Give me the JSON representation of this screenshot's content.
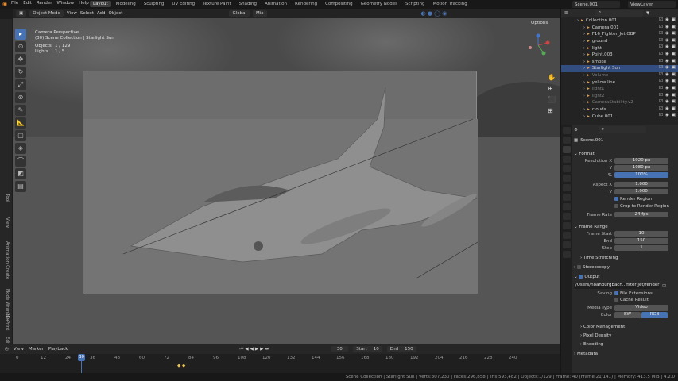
{
  "menu": [
    "File",
    "Edit",
    "Render",
    "Window",
    "Help"
  ],
  "workspaces": [
    "Layout",
    "Modeling",
    "Sculpting",
    "UV Editing",
    "Texture Paint",
    "Shading",
    "Animation",
    "Rendering",
    "Compositing",
    "Geometry Nodes",
    "Scripting",
    "Motion Tracking"
  ],
  "scene_name": "Scene.001",
  "view_layer": "ViewLayer",
  "viewport_header": {
    "mode": "Object Mode",
    "view": "View",
    "select": "Select",
    "add": "Add",
    "object": "Object",
    "orientation": "Global",
    "pivot": "Mix",
    "options": "Options"
  },
  "overlay": {
    "line1": "Camera Perspective",
    "line2": "(30) Scene Collection | Starlight Sun",
    "objects_label": "Objects",
    "objects_value": "1 / 129",
    "lights_label": "Lights",
    "lights_value": "1 / 5"
  },
  "outliner": [
    {
      "name": "Collection.001",
      "state": "normal"
    },
    {
      "name": "Camera.001",
      "state": "normal"
    },
    {
      "name": "F16_Fighter_Jet.OBP",
      "state": "normal"
    },
    {
      "name": "ground",
      "state": "normal"
    },
    {
      "name": "light",
      "state": "normal"
    },
    {
      "name": "Point.003",
      "state": "normal"
    },
    {
      "name": "smoke",
      "state": "normal"
    },
    {
      "name": "Starlight Sun",
      "state": "selected"
    },
    {
      "name": "Volume",
      "state": "dim"
    },
    {
      "name": "yellow line",
      "state": "normal"
    },
    {
      "name": "light1",
      "state": "dim"
    },
    {
      "name": "light2",
      "state": "dim"
    },
    {
      "name": "CameraStability.v2",
      "state": "dim"
    },
    {
      "name": "clouds",
      "state": "normal"
    },
    {
      "name": "Cube.001",
      "state": "normal"
    }
  ],
  "properties": {
    "scene": "Scene.001",
    "format_title": "Format",
    "res_x_label": "Resolution X",
    "res_x": "1920 px",
    "res_y_label": "Y",
    "res_y": "1080 px",
    "res_pct_label": "%",
    "res_pct": "100%",
    "aspect_x_label": "Aspect X",
    "aspect_x": "1.000",
    "aspect_y_label": "Y",
    "aspect_y": "1.000",
    "render_region": "Render Region",
    "crop_region": "Crop to Render Region",
    "frame_rate_label": "Frame Rate",
    "frame_rate": "24 fps",
    "frame_range_title": "Frame Range",
    "frame_start_label": "Frame Start",
    "frame_start": "10",
    "end_label": "End",
    "end": "150",
    "step_label": "Step",
    "step": "1",
    "time_stretching": "Time Stretching",
    "stereoscopy": "Stereoscopy",
    "output_title": "Output",
    "output_path": "/Users/noahburgbach...fster jet/render test/\\/",
    "saving_label": "Saving",
    "file_ext": "File Extensions",
    "cache_result": "Cache Result",
    "media_type_label": "Media Type",
    "media_type": "Video",
    "color_label": "Color",
    "bw": "BW",
    "rgb": "RGB",
    "color_mgmt": "Color Management",
    "pixel_density": "Pixel Density",
    "encoding": "Encoding",
    "metadata": "Metadata"
  },
  "timeline": {
    "playback": "Playback",
    "view": "View",
    "marker": "Marker",
    "current": "30",
    "start_label": "Start",
    "start": "10",
    "end_label": "End",
    "end": "150",
    "ticks": [
      "0",
      "12",
      "24",
      "36",
      "48",
      "60",
      "72",
      "84",
      "96",
      "108",
      "120",
      "132",
      "144",
      "156",
      "168",
      "180",
      "192",
      "204",
      "216",
      "228",
      "240"
    ]
  },
  "left_labels": [
    "Tool",
    "View",
    "Animation",
    "Create",
    "Node Wrangler",
    "3D-Print",
    "Edit"
  ],
  "status": "Scene Collection | Starlight Sun | Verts:307,230 | Faces:296,858 | Tris:593,482 | Objects:1/129 | Frame: 40 (Frame:21/141) | Memory: 413.5 MiB | 4.2.0",
  "colors": {
    "accent": "#4772b3",
    "selected_row": "#334d80"
  }
}
